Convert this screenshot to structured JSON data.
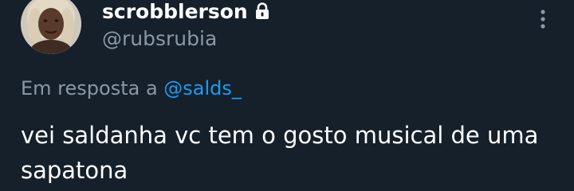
{
  "author": {
    "display_name": "scrobblerson",
    "handle": "@rubsrubia",
    "avatar": "avatar",
    "protected_icon": "lock-icon"
  },
  "more_icon": "more-vertical-icon",
  "reply": {
    "prefix": "Em resposta a ",
    "mention": "@salds_"
  },
  "tweet": {
    "text": "vei saldanha vc tem o gosto musical de uma sapatona"
  },
  "colors": {
    "background": "#15202b",
    "primary_text": "#ffffff",
    "secondary_text": "#8b98a5",
    "accent": "#1d9bf0"
  }
}
